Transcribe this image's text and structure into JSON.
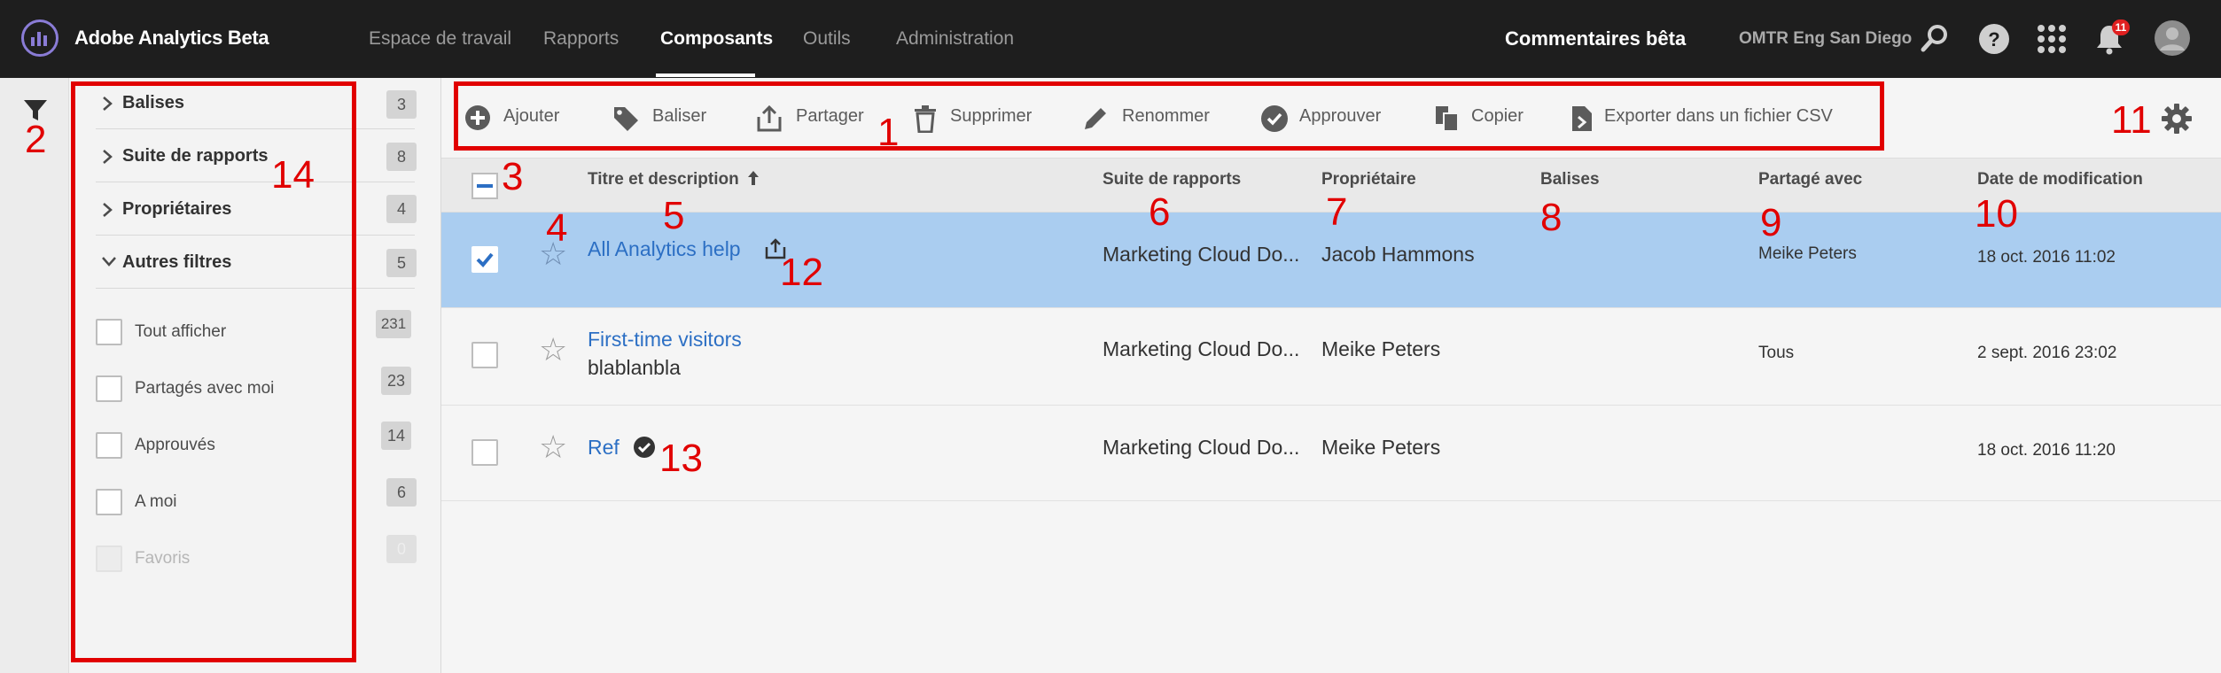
{
  "app": {
    "title": "Adobe Analytics Beta"
  },
  "nav": {
    "items": [
      {
        "label": "Espace de travail"
      },
      {
        "label": "Rapports"
      },
      {
        "label": "Composants"
      },
      {
        "label": "Outils"
      },
      {
        "label": "Administration"
      }
    ],
    "active": "Composants"
  },
  "header_right": {
    "feedback": "Commentaires bêta",
    "org": "OMTR Eng San Diego",
    "notification_count": "11",
    "icons": [
      "search-icon",
      "help-icon",
      "apps-grid-icon",
      "bell-icon",
      "avatar"
    ]
  },
  "filters": {
    "groups": [
      {
        "label": "Balises",
        "count": "3",
        "expanded": false
      },
      {
        "label": "Suite de rapports",
        "count": "8",
        "expanded": false
      },
      {
        "label": "Propriétaires",
        "count": "4",
        "expanded": false
      },
      {
        "label": "Autres filtres",
        "count": "5",
        "expanded": true
      }
    ],
    "options": [
      {
        "label": "Tout afficher",
        "count": "231",
        "enabled": true
      },
      {
        "label": "Partagés avec moi",
        "count": "23",
        "enabled": true
      },
      {
        "label": "Approuvés",
        "count": "14",
        "enabled": true
      },
      {
        "label": "A moi",
        "count": "6",
        "enabled": true
      },
      {
        "label": "Favoris",
        "count": "0",
        "enabled": false
      }
    ]
  },
  "toolbar": {
    "actions": [
      {
        "label": "Ajouter",
        "icon": "add-icon"
      },
      {
        "label": "Baliser",
        "icon": "tag-icon"
      },
      {
        "label": "Partager",
        "icon": "share-icon"
      },
      {
        "label": "Supprimer",
        "icon": "trash-icon"
      },
      {
        "label": "Renommer",
        "icon": "pencil-icon"
      },
      {
        "label": "Approuver",
        "icon": "check-circle-icon"
      },
      {
        "label": "Copier",
        "icon": "copy-icon"
      },
      {
        "label": "Exporter dans un fichier CSV",
        "icon": "export-csv-icon"
      }
    ],
    "settings_icon": "gear-icon"
  },
  "table": {
    "columns": [
      {
        "label": "Titre et description",
        "sorted": "ascending"
      },
      {
        "label": "Suite de rapports"
      },
      {
        "label": "Propriétaire"
      },
      {
        "label": "Balises"
      },
      {
        "label": "Partagé avec"
      },
      {
        "label": "Date de modification"
      }
    ],
    "rows": [
      {
        "selected": true,
        "title": "All Analytics help",
        "description": "",
        "suite": "Marketing Cloud Do...",
        "owner": "Jacob Hammons",
        "tags": "",
        "shared_with": "Meike Peters",
        "modified": "18 oct. 2016 11:02",
        "badge_icon": "shared-icon"
      },
      {
        "selected": false,
        "title": "First-time visitors",
        "description": "blablanbla",
        "suite": "Marketing Cloud Do...",
        "owner": "Meike Peters",
        "tags": "",
        "shared_with": "Tous",
        "modified": "2 sept. 2016 23:02",
        "badge_icon": ""
      },
      {
        "selected": false,
        "title": "Ref",
        "description": "",
        "suite": "Marketing Cloud Do...",
        "owner": "Meike Peters",
        "tags": "",
        "shared_with": "",
        "modified": "18 oct. 2016 11:20",
        "badge_icon": "approved-icon"
      }
    ]
  },
  "callouts": {
    "color": "#e10000",
    "numbers": [
      "1",
      "2",
      "3",
      "4",
      "5",
      "6",
      "7",
      "8",
      "9",
      "10",
      "11",
      "12",
      "13",
      "14"
    ]
  }
}
